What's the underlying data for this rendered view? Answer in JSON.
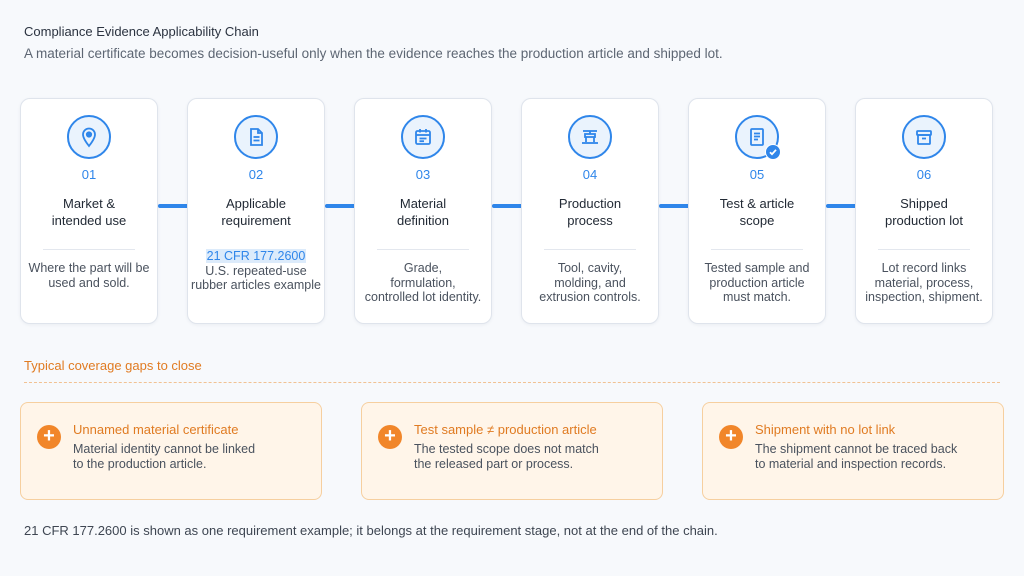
{
  "header": {
    "title": "Compliance Evidence Applicability Chain",
    "subtitle": "A material certificate becomes decision-useful only when the evidence reaches the production article and shipped lot."
  },
  "stages": [
    {
      "icon": "location-pin-icon",
      "number": "01",
      "label_line1": "Market &",
      "label_line2": "intended use",
      "desc_lines": [
        "Where the part will be",
        "used and sold."
      ]
    },
    {
      "icon": "document-icon",
      "number": "02",
      "label_line1": "Applicable",
      "label_line2": "requirement",
      "desc_highlight": "21 CFR 177.2600",
      "desc_lines": [
        "U.S. repeated-use",
        "rubber articles example"
      ]
    },
    {
      "icon": "calendar-icon",
      "number": "03",
      "label_line1": "Material",
      "label_line2": "definition",
      "desc_lines": [
        "Grade,",
        "formulation,",
        "controlled lot identity."
      ]
    },
    {
      "icon": "press-icon",
      "number": "04",
      "label_line1": "Production",
      "label_line2": "process",
      "desc_lines": [
        "Tool, cavity,",
        "molding, and",
        "extrusion controls."
      ]
    },
    {
      "icon": "verified-document-icon",
      "number": "05",
      "label_line1": "Test & article",
      "label_line2": "scope",
      "desc_lines": [
        "Tested sample and",
        "production article",
        "must match."
      ]
    },
    {
      "icon": "box-icon",
      "number": "06",
      "label_line1": "Shipped",
      "label_line2": "production lot",
      "desc_lines": [
        "Lot record links",
        "material, process,",
        "inspection, shipment."
      ]
    }
  ],
  "gaps": {
    "heading": "Typical coverage gaps to close",
    "items": [
      {
        "title": "Unnamed material certificate",
        "line1": "Material identity cannot be linked",
        "line2": "to the production article."
      },
      {
        "title": "Test sample ≠ production article",
        "line1": "The tested scope does not match",
        "line2": "the released part or process."
      },
      {
        "title": "Shipment with no lot link",
        "line1": "The shipment cannot be traced back",
        "line2": "to material and inspection records."
      }
    ]
  },
  "footnote": "21 CFR 177.2600 is shown as one requirement example; it belongs at the requirement stage, not at the end of the chain.",
  "colors": {
    "accent": "#2f86ea",
    "warning": "#f1862a",
    "warning_text": "#e07b22"
  }
}
